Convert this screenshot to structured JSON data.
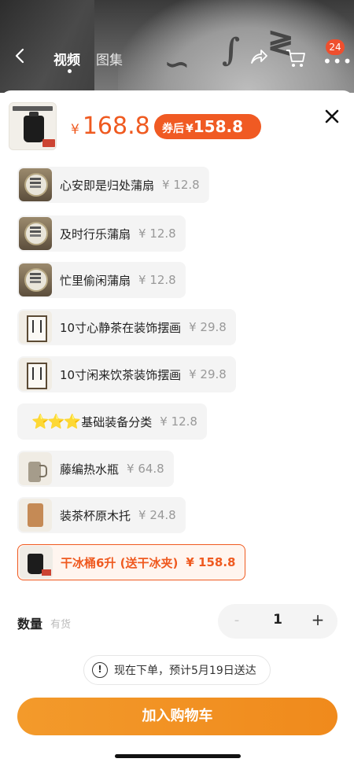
{
  "nav": {
    "tabs": [
      "视频",
      "图集"
    ],
    "cart_badge": "24"
  },
  "product": {
    "price_currency": "¥",
    "price": "168.8",
    "coupon_label": "券后",
    "coupon_currency": "¥",
    "coupon_price": "158.8"
  },
  "options": [
    {
      "name": "心安即是归处蒲扇",
      "price": "¥ 12.8",
      "icon": "fan-icon"
    },
    {
      "name": "及时行乐蒲扇",
      "price": "¥ 12.8",
      "icon": "fan-icon"
    },
    {
      "name": "忙里偷闲蒲扇",
      "price": "¥ 12.8",
      "icon": "fan-icon"
    },
    {
      "name": "10寸心静茶在装饰摆画",
      "price": "¥ 29.8",
      "icon": "frame-icon"
    },
    {
      "name": "10寸闲来饮茶装饰摆画",
      "price": "¥ 29.8",
      "icon": "frame-icon"
    },
    {
      "name": "基础装备分类",
      "price": "¥ 12.8",
      "icon": "star-icon",
      "prefix": "⭐⭐⭐"
    },
    {
      "name": "藤编热水瓶",
      "price": "¥ 64.8",
      "icon": "thermos-icon"
    },
    {
      "name": "装茶杯原木托",
      "price": "¥ 24.8",
      "icon": "tray-icon"
    },
    {
      "name": "干冰桶6升 (送干冰夹)",
      "price": "¥ 158.8",
      "icon": "kettle-icon",
      "selected": true
    }
  ],
  "quantity": {
    "label": "数量",
    "stock": "有货",
    "minus": "-",
    "value": "1",
    "plus": "+"
  },
  "delivery": {
    "info_icon": "!",
    "text": "现在下单，预计5月19日送达"
  },
  "add_to_cart": "加入购物车",
  "colors": {
    "accent": "#ef5a20",
    "cart_button": "#f39a2b"
  }
}
